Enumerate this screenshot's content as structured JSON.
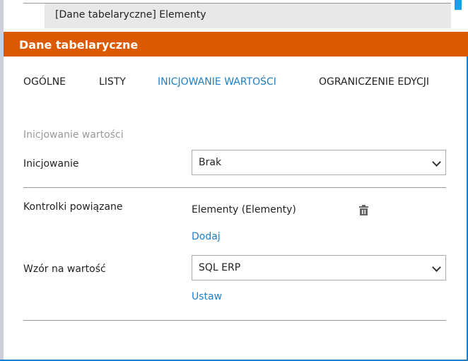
{
  "breadcrumb": "[Dane tabelaryczne] Elementy",
  "header": {
    "title": "Dane tabelaryczne"
  },
  "tabs": [
    {
      "label": "OGÓLNE"
    },
    {
      "label": "LISTY"
    },
    {
      "label": "INICJOWANIE WARTOŚCI"
    },
    {
      "label": "OGRANICZENIE EDYCJI"
    }
  ],
  "section_title": "Inicjowanie wartości",
  "form": {
    "init_label": "Inicjowanie",
    "init_value": "Brak",
    "related_label": "Kontrolki powiązane",
    "related_value": "Elementy (Elementy)",
    "add_link": "Dodaj",
    "pattern_label": "Wzór na wartość",
    "pattern_value": "SQL ERP",
    "set_link": "Ustaw"
  },
  "colors": {
    "accent": "#db5a00",
    "link": "#1e7fc8"
  }
}
